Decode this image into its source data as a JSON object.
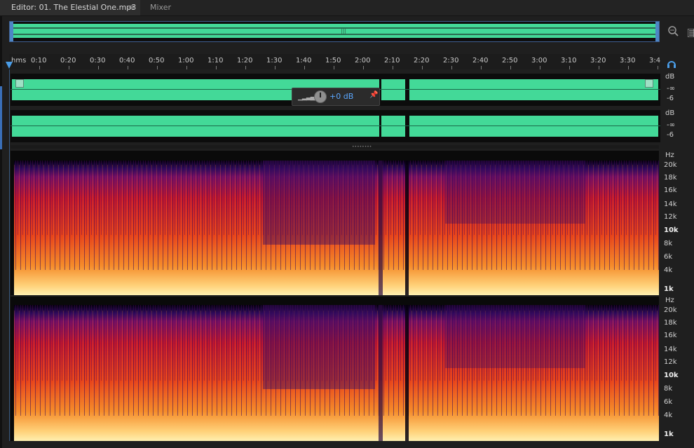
{
  "tabs": {
    "editor_label": "Editor: 01. The Elestial One.mp3",
    "menu_glyph": "≡",
    "mixer_label": "Mixer"
  },
  "ruler": {
    "unit": "hms",
    "labels": [
      "0:10",
      "0:20",
      "0:30",
      "0:40",
      "0:50",
      "1:00",
      "1:10",
      "1:20",
      "1:30",
      "1:40",
      "1:50",
      "2:00",
      "2:10",
      "2:20",
      "2:30",
      "2:40",
      "2:50",
      "3:00",
      "3:10",
      "3:20",
      "3:30",
      "3:4"
    ]
  },
  "hud": {
    "value": "+0 dB"
  },
  "amplitude": {
    "unit": "dB",
    "ticks": [
      "-∞",
      "-6"
    ]
  },
  "spectral": {
    "unit": "Hz",
    "ticks": [
      "20k",
      "18k",
      "16k",
      "14k",
      "12k",
      "10k",
      "8k",
      "6k",
      "4k",
      "1k"
    ],
    "bold_ticks": [
      "10k",
      "1k"
    ]
  },
  "colors": {
    "waveform": "#43d998",
    "selection_accent": "#4a9de8",
    "spectral_high": "#ffd27a",
    "spectral_low": "#2a0a5a"
  },
  "icons": {
    "zoom": "zoom-selection-icon",
    "panel": "panel-menu-icon",
    "headphones": "headphones-icon"
  }
}
